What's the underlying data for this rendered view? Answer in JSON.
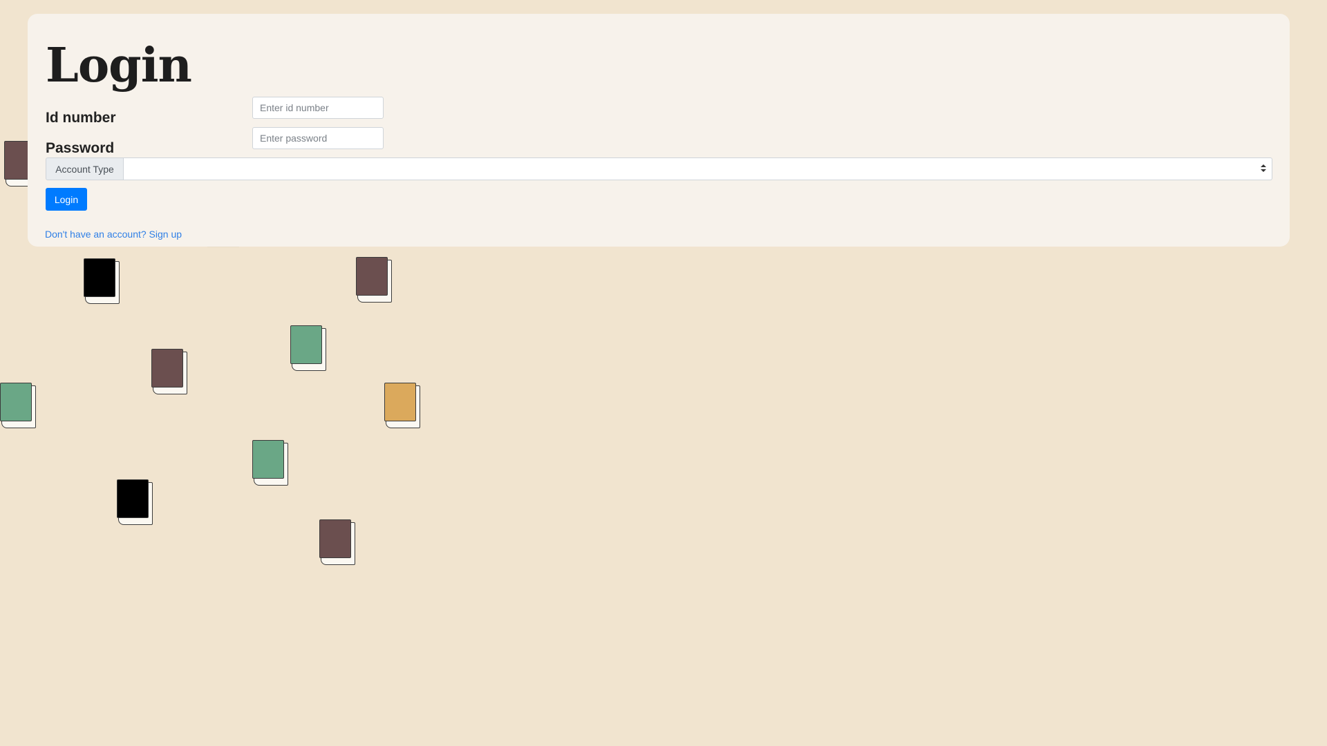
{
  "colors": {
    "background": "#f1e4cf",
    "card": "#f7f2eb",
    "primary": "#007bff",
    "link": "#2f7fe6",
    "book_brown": "#6b4f4f",
    "book_black": "#000000",
    "book_green": "#6aa786",
    "book_gold": "#dba95c"
  },
  "login_form": {
    "title": "Login",
    "id_label": "Id number",
    "id_placeholder": "Enter id number",
    "id_value": "",
    "password_label": "Password",
    "password_placeholder": "Enter password",
    "password_value": "",
    "account_type_label": "Account Type",
    "account_type_value": "",
    "submit_label": "Login",
    "signup_link": "Don't have an account? Sign up"
  },
  "background_decoration": {
    "icon": "book-icon",
    "books": [
      "brown",
      "black",
      "brown",
      "green",
      "brown",
      "green",
      "gold",
      "green",
      "black",
      "brown"
    ]
  }
}
